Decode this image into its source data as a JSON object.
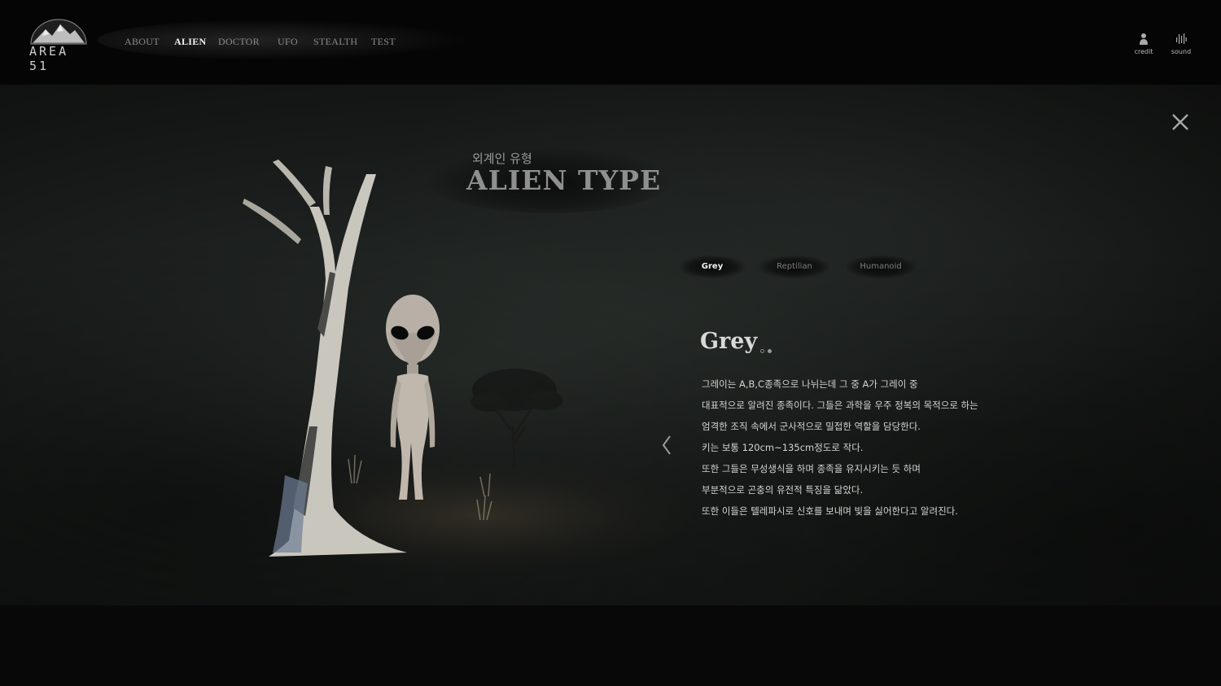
{
  "header": {
    "logo_text": "AREA 51",
    "nav": [
      "ABOUT",
      "ALIEN",
      "DOCTOR",
      "UFO",
      "STEALTH",
      "TEST"
    ],
    "active_nav": "ALIEN",
    "tools": [
      {
        "label": "credit",
        "icon": "person-icon"
      },
      {
        "label": "sound",
        "icon": "sound-bars-icon"
      }
    ]
  },
  "section": {
    "kr_title": "외계인 유형",
    "en_title": "ALIEN TYPE"
  },
  "tabs": {
    "items": [
      "Grey",
      "Reptilian",
      "Humanoid"
    ],
    "active": "Grey"
  },
  "detail": {
    "title": "Grey",
    "page_dots": 2,
    "active_dot": 2,
    "lines": [
      "그레이는 A,B,C종족으로 나뉘는데 그 중 A가 그레이 중",
      "대표적으로 알려진 종족이다. 그들은 과학을 우주 정복의 목적으로 하는",
      "엄격한 조직 속에서 군사적으로 밀접한 역할을 담당한다.",
      "키는 보통 120cm~135cm정도로 작다.",
      "또한 그들은 무성생식을 하며 종족을 유지시키는 듯 하며",
      "부분적으로 곤충의 유전적 특징을 닮았다.",
      "또한 이들은 텔레파시로 신호를 보내며 빛을 싫어한다고 알려진다."
    ]
  },
  "colors": {
    "background": "#080808",
    "stage": "#1d211f",
    "text_active": "#f2f2f2",
    "text_muted": "#8a8a8a"
  }
}
